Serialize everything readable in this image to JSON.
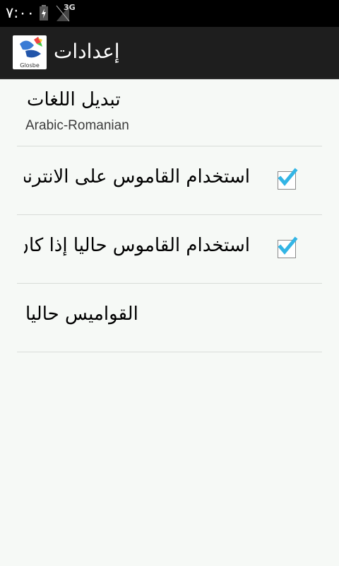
{
  "status_bar": {
    "time": "٧:٠٠",
    "network": "3G"
  },
  "action_bar": {
    "title": "إعدادات",
    "app_icon_label": "Glosbe"
  },
  "settings": {
    "change_languages": {
      "title": "تبديل اللغات",
      "summary": "Arabic-Romanian"
    },
    "online_dictionary": {
      "title": "استخدام القاموس على الانترنت",
      "checked": true
    },
    "current_dictionary": {
      "title": "استخدام القاموس حاليا إذا كان",
      "checked": true
    },
    "current_dictionaries": {
      "title": "القواميس حاليا"
    }
  },
  "colors": {
    "check_accent": "#33b5e5",
    "divider": "#d8dcd8",
    "background": "#f6f9f6"
  }
}
